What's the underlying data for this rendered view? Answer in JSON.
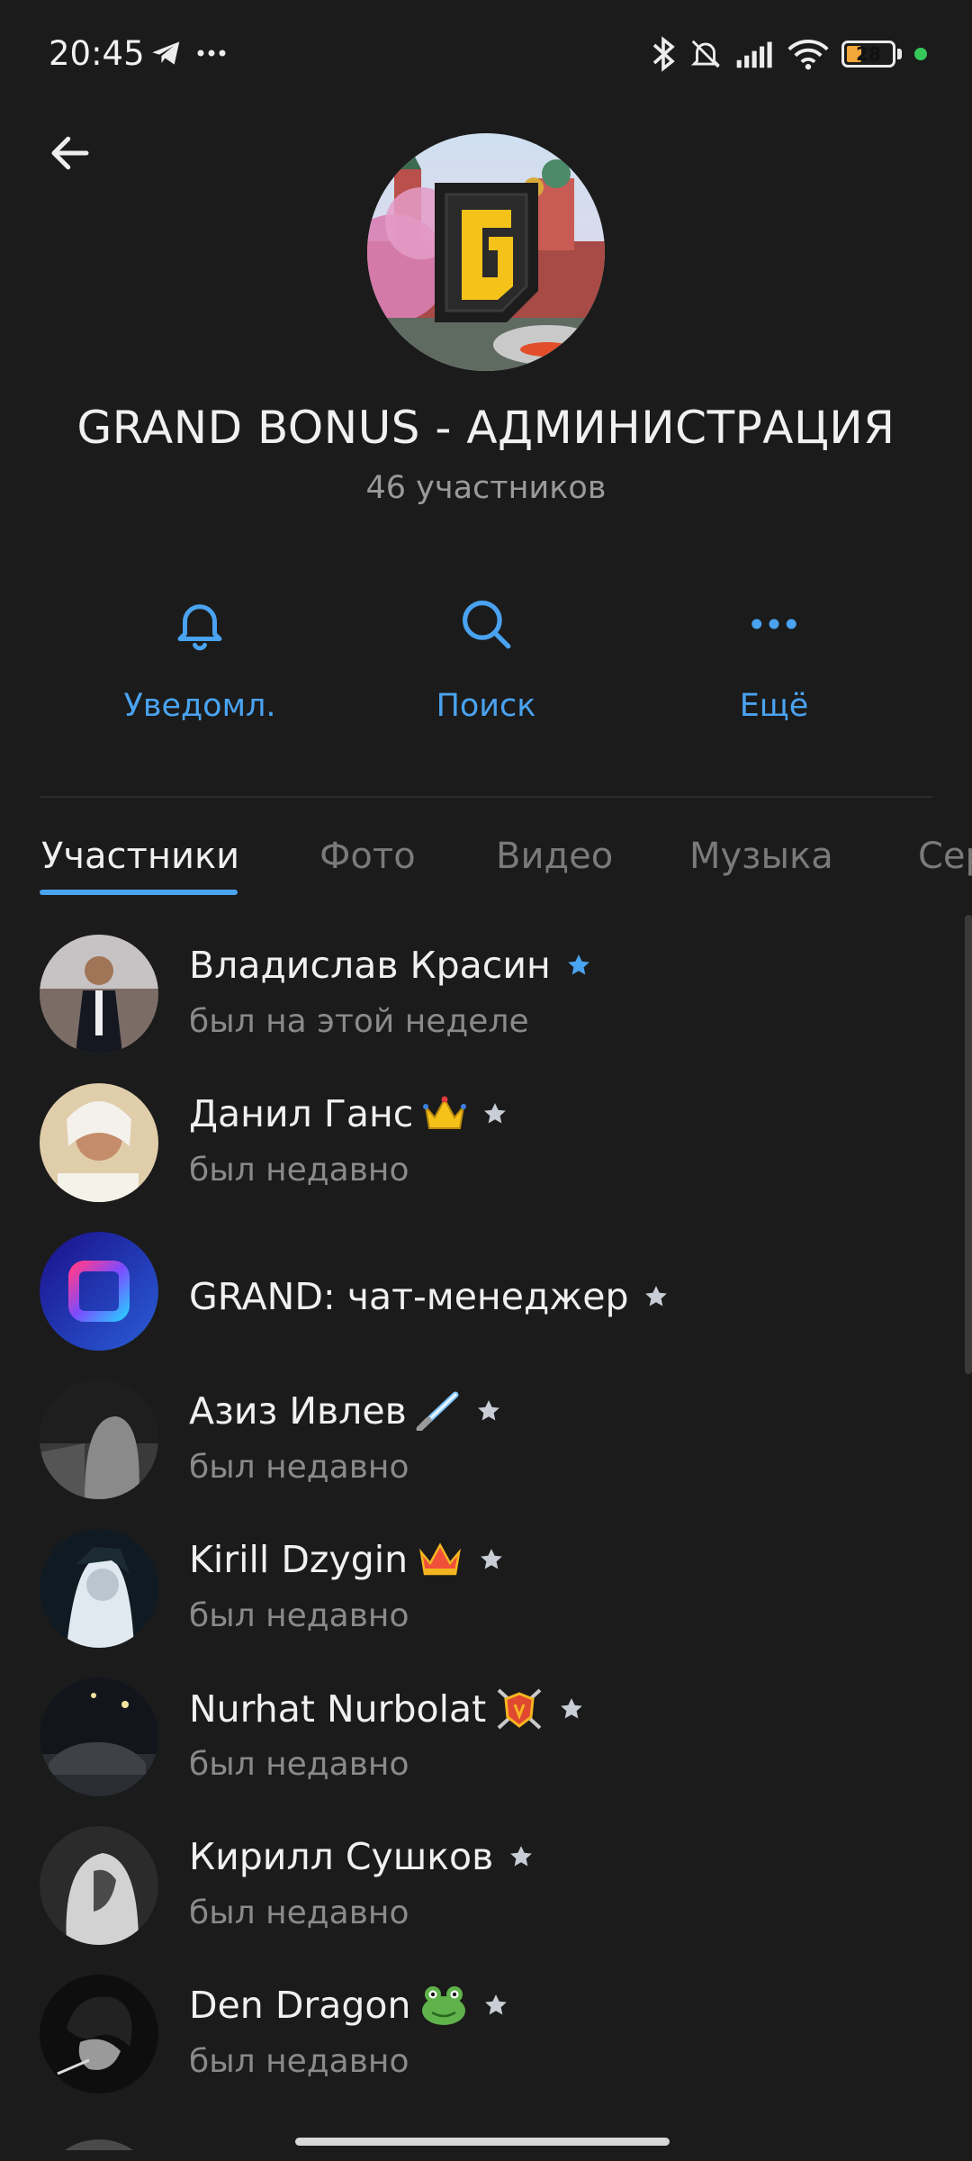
{
  "status_bar": {
    "time": "20:45",
    "battery": "28"
  },
  "header": {
    "title": "GRAND BONUS - АДМИНИСТРАЦИЯ",
    "subtitle": "46 участников"
  },
  "actions": [
    {
      "label": "Уведомл.",
      "icon": "bell-icon"
    },
    {
      "label": "Поиск",
      "icon": "search-icon"
    },
    {
      "label": "Ещё",
      "icon": "more-dots-icon"
    }
  ],
  "tabs": [
    {
      "label": "Участники",
      "active": true
    },
    {
      "label": "Фото"
    },
    {
      "label": "Видео"
    },
    {
      "label": "Музыка"
    },
    {
      "label": "Сер"
    }
  ],
  "members": [
    {
      "name": "Владислав Красин",
      "status": "был на этой неделе",
      "badge": "",
      "star": "blue"
    },
    {
      "name": "Данил Ганс",
      "status": "был недавно",
      "badge": "crown-gold",
      "star": "gray"
    },
    {
      "name": "GRAND: чат-менеджер",
      "status": "",
      "badge": "",
      "star": "gray"
    },
    {
      "name": "Азиз Ивлев",
      "status": "был недавно",
      "badge": "lightsaber",
      "star": "gray"
    },
    {
      "name": "Kirill Dzygin",
      "status": "был недавно",
      "badge": "crown-red",
      "star": "gray"
    },
    {
      "name": "Nurhat Nurbolat",
      "status": "был недавно",
      "badge": "shield-swords",
      "star": "gray"
    },
    {
      "name": "Кирилл Сушков",
      "status": "был недавно",
      "badge": "",
      "star": "gray"
    },
    {
      "name": "Den Dragon",
      "status": "был недавно",
      "badge": "frog",
      "star": "gray"
    }
  ],
  "colors": {
    "accent": "#4aa3f0",
    "background": "#1b1b1b",
    "muted": "#8a8a8a"
  }
}
